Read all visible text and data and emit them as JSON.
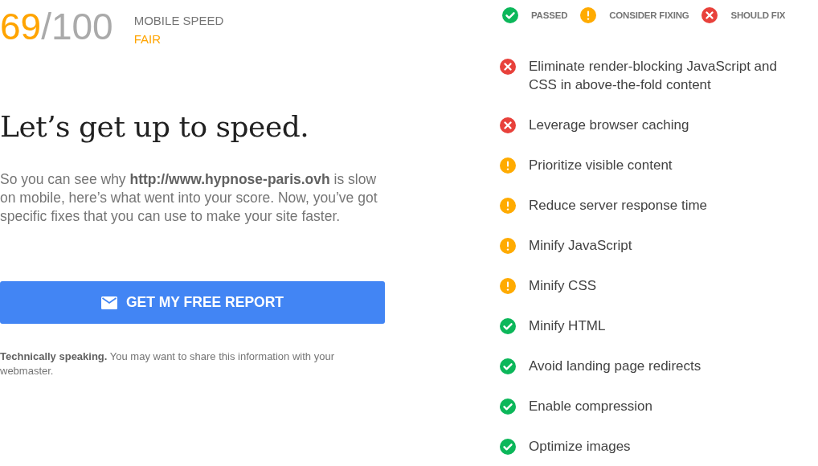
{
  "score": {
    "value": "69",
    "total": "/100",
    "label": "MOBILE SPEED",
    "rating": "FAIR"
  },
  "heading": "Let’s get up to speed.",
  "intro": "So you can see why **http://www.hypnose-paris.ovh** is slow on mobile, here’s what went into your score. Now, you’ve got specific fixes that you can use to make your site faster.",
  "report_button": "GET MY FREE REPORT",
  "note": "**Technically speaking.** You may want to share this information with your webmaster.",
  "legend": [
    {
      "kind": "passed",
      "label": "PASSED"
    },
    {
      "kind": "consider",
      "label": "CONSIDER FIXING"
    },
    {
      "kind": "fix",
      "label": "SHOULD FIX"
    }
  ],
  "rules": [
    {
      "kind": "fix",
      "label": "Eliminate render-blocking JavaScript and CSS in above-the-fold content"
    },
    {
      "kind": "fix",
      "label": "Leverage browser caching"
    },
    {
      "kind": "consider",
      "label": "Prioritize visible content"
    },
    {
      "kind": "consider",
      "label": "Reduce server response time"
    },
    {
      "kind": "consider",
      "label": "Minify JavaScript"
    },
    {
      "kind": "consider",
      "label": "Minify CSS"
    },
    {
      "kind": "passed",
      "label": "Minify HTML"
    },
    {
      "kind": "passed",
      "label": "Avoid landing page redirects"
    },
    {
      "kind": "passed",
      "label": "Enable compression"
    },
    {
      "kind": "passed",
      "label": "Optimize images"
    }
  ]
}
